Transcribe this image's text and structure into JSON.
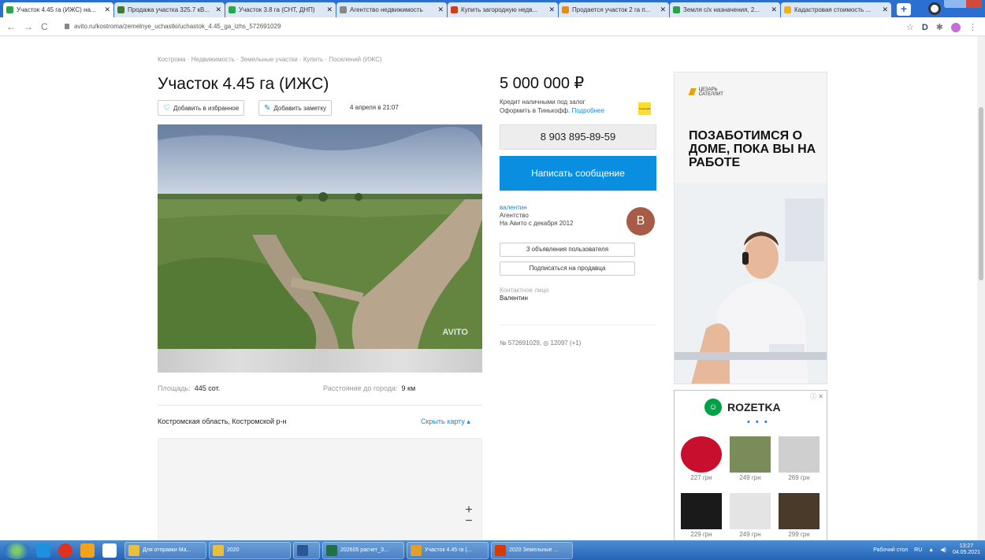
{
  "browser": {
    "tabs": [
      {
        "title": "Участок 4.45 га (ИЖС) на...",
        "color": "#2ea44f",
        "active": true
      },
      {
        "title": "Продажа участка 325.7 кВ...",
        "color": "#3a7d2c"
      },
      {
        "title": "Участок 3.8 га (СНТ, ДНП)",
        "color": "#2ea44f"
      },
      {
        "title": "Агентство недвижимость",
        "color": "#888888"
      },
      {
        "title": "Купить загородную недв...",
        "color": "#c8401f"
      },
      {
        "title": "Продается участок 2 га п...",
        "color": "#e88a1a"
      },
      {
        "title": "Земля с/х назначения, 2...",
        "color": "#2b9f4e"
      },
      {
        "title": "Кадастровая стоимость ...",
        "color": "#f0b020"
      }
    ],
    "url": "avito.ru/kostroma/zemelnye_uchastki/uchastok_4.45_ga_izhs_572691029"
  },
  "listing": {
    "breadcrumb": "Кострома · Недвижимость · Земельные участки · Купить · Поселений (ИЖС)",
    "title": "Участок 4.45 га (ИЖС)",
    "favorite_label": "Добавить в избранное",
    "note_label": "Добавить заметку",
    "date": "4 апреля в 21:07",
    "watermark": "AVITO",
    "area_label": "Площадь:",
    "area_value": "445 сот.",
    "distance_label": "Расстояние до города:",
    "distance_value": "9 км",
    "location": "Костромская область, Костромской р-н",
    "hide_map": "Скрыть карту ▴",
    "zoom_in": "+",
    "zoom_out": "−"
  },
  "sidebar": {
    "price": "5 000 000 ₽",
    "credit_line1": "Кредит наличными под залог",
    "credit_line2": "Оформить в Тинькофф.",
    "credit_more": "Подробнее",
    "tinkoff_mark": "Тинькофф",
    "phone": "8 903 895-89-59",
    "message": "Написать сообщение",
    "seller_name": "валентин",
    "seller_type": "Агентство",
    "seller_since": "На Авито с декабря 2012",
    "avatar_letter": "В",
    "ads_count": "3 объявления пользователя",
    "subscribe": "Подписаться на продавца",
    "contact_label": "Контактное лицо",
    "contact_name": "Валентин",
    "stats": "№ 572691029, ◎ 12097 (+1)"
  },
  "ad_banner": {
    "brand_mark": "/////",
    "brand_line1": "ЦЕЗАРЬ",
    "brand_line2": "САТЕЛЛИТ",
    "headline": "ПОЗАБОТИМСЯ О ДОМЕ, ПОКА ВЫ НА РАБОТЕ"
  },
  "ad_rozetka": {
    "info": "ⓘ ✕",
    "brand": "ROZETKA",
    "dots": "• • •",
    "products": [
      {
        "price": "227 грн",
        "color": "#c8102e"
      },
      {
        "price": "249 грн",
        "color": "#7a8c5a"
      },
      {
        "price": "269 грн",
        "color": "#cfcfcf"
      },
      {
        "price": "229 грн",
        "color": "#1a1a1a"
      },
      {
        "price": "249 грн",
        "color": "#e4e4e4"
      },
      {
        "price": "299 грн",
        "color": "#4a3a2a"
      }
    ]
  },
  "taskbar": {
    "items": [
      {
        "label": "Для отправки Ма...",
        "color": "#e8c040"
      },
      {
        "label": "2020",
        "color": "#e8c040"
      },
      {
        "label": "",
        "color": "#2b5797"
      },
      {
        "label": "202605 расчет_З...",
        "color": "#1e7145"
      },
      {
        "label": "Участок 4.45 га (...",
        "color": "#e0a030"
      },
      {
        "label": "2020 Земельные ...",
        "color": "#d83b01"
      }
    ],
    "desktop_label": "Рабочий стол",
    "lang": "RU",
    "time": "13:27",
    "date": "04.05.2021"
  }
}
